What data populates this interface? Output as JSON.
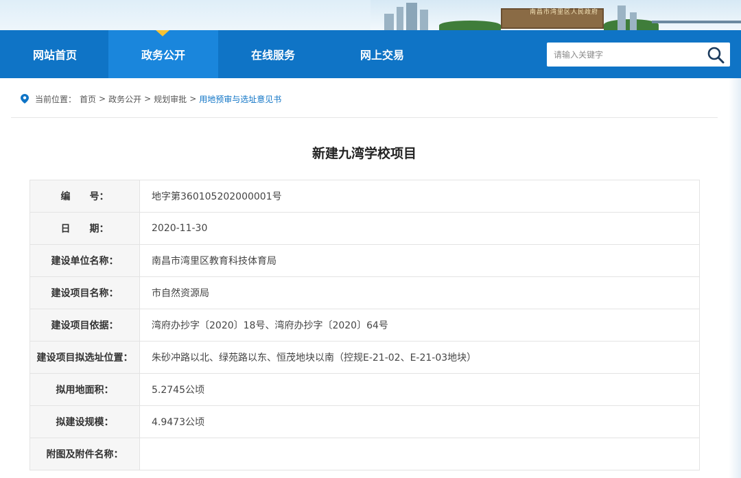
{
  "banner": {
    "gate_text": "南昌市湾里区人民政府"
  },
  "nav": {
    "items": [
      {
        "label": "网站首页"
      },
      {
        "label": "政务公开"
      },
      {
        "label": "在线服务"
      },
      {
        "label": "网上交易"
      }
    ],
    "active_index": 1
  },
  "search": {
    "placeholder": "请输入关键字"
  },
  "breadcrumb": {
    "prefix": "当前位置：",
    "items": [
      "首页",
      "政务公开",
      "规划审批",
      "用地预审与选址意见书"
    ],
    "separator": ">"
  },
  "title": "新建九湾学校项目",
  "rows": [
    {
      "label": "编　　号：",
      "value": "地字第360105202000001号"
    },
    {
      "label": "日　　期：",
      "value": "2020-11-30"
    },
    {
      "label": "建设单位名称：",
      "value": "南昌市湾里区教育科技体育局"
    },
    {
      "label": "建设项目名称：",
      "value": "市自然资源局"
    },
    {
      "label": "建设项目依据：",
      "value": "湾府办抄字〔2020〕18号、湾府办抄字〔2020〕64号"
    },
    {
      "label": "建设项目拟选址位置：",
      "value": "朱砂冲路以北、绿苑路以东、恒茂地块以南（控规E-21-02、E-21-03地块）"
    },
    {
      "label": "拟用地面积：",
      "value": "5.2745公顷"
    },
    {
      "label": "拟建设规模：",
      "value": "4.9473公顷"
    },
    {
      "label": "附图及附件名称：",
      "value": ""
    }
  ],
  "colors": {
    "nav": "#0f74c6",
    "nav_active": "#1a86dc",
    "caret": "#f6c233",
    "link": "#0f74c6"
  }
}
